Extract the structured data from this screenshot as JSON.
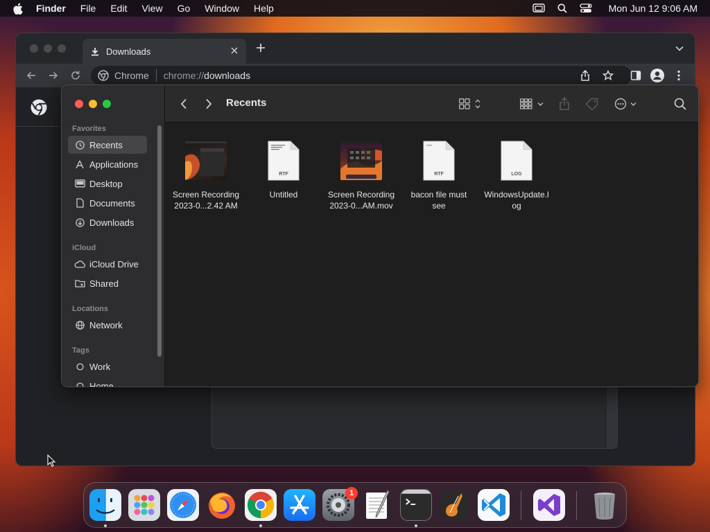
{
  "menubar": {
    "app_name": "Finder",
    "menus": [
      "File",
      "Edit",
      "View",
      "Go",
      "Window",
      "Help"
    ],
    "clock": "Mon Jun 12  9:06 AM"
  },
  "chrome": {
    "tab_title": "Downloads",
    "omnibox": {
      "chip": "Chrome",
      "url_scheme": "chrome://",
      "url_host": "downloads"
    }
  },
  "finder": {
    "title": "Recents",
    "sidebar": {
      "favorites_label": "Favorites",
      "favorites": [
        "Recents",
        "Applications",
        "Desktop",
        "Documents",
        "Downloads"
      ],
      "icloud_label": "iCloud",
      "icloud": [
        "iCloud Drive",
        "Shared"
      ],
      "locations_label": "Locations",
      "locations": [
        "Network"
      ],
      "tags_label": "Tags",
      "tags": [
        "Work",
        "Home"
      ]
    },
    "files": [
      {
        "name_line1": "Screen Recording",
        "name_line2": "2023-0...2.42 AM",
        "kind": "video"
      },
      {
        "name_line1": "Untitled",
        "name_line2": "",
        "kind": "doc",
        "ext": "RTF"
      },
      {
        "name_line1": "Screen Recording",
        "name_line2": "2023-0...AM.mov",
        "kind": "video"
      },
      {
        "name_line1": "bacon file must",
        "name_line2": "see",
        "kind": "doc",
        "ext": "RTF"
      },
      {
        "name_line1": "WindowsUpdate.l",
        "name_line2": "og",
        "kind": "doc",
        "ext": "LOG"
      }
    ]
  },
  "dock": {
    "apps": [
      "finder",
      "launchpad",
      "safari",
      "firefox",
      "chrome",
      "app-store",
      "system-settings",
      "textedit",
      "terminal",
      "garageband",
      "vscode",
      "visual-studio",
      "trash"
    ],
    "system_settings_badge": "1"
  },
  "colors": {
    "close": "#ff5f57",
    "minimize": "#febc2e",
    "zoom": "#28c840",
    "sidebar_selected": "#454447",
    "badge": "#ff3b30"
  }
}
